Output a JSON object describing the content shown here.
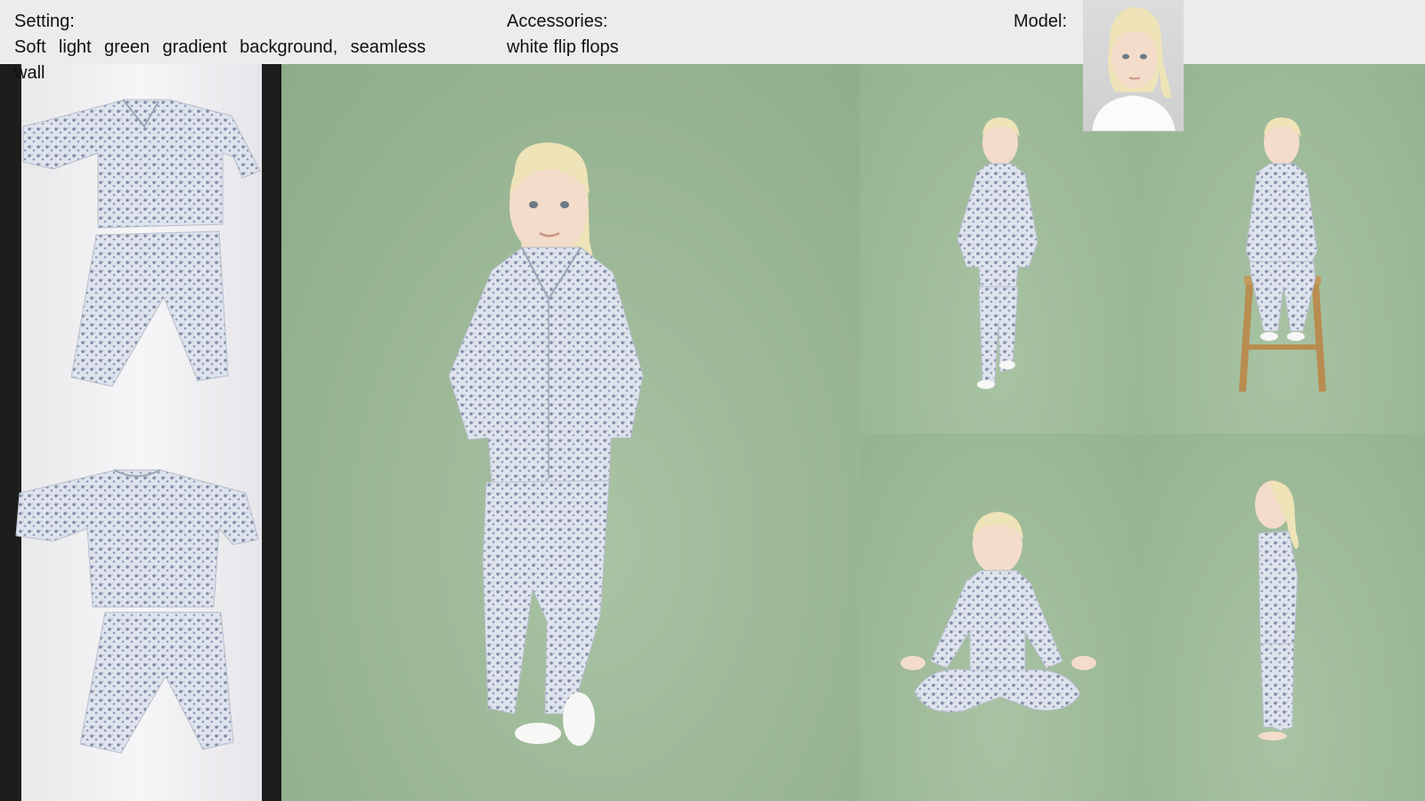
{
  "header": {
    "setting_label": "Setting:",
    "setting_value": "Soft light green gradient background, seamless wall",
    "accessories_label": "Accessories:",
    "accessories_value": "white flip flops",
    "model_label": "Model:"
  },
  "colors": {
    "backdrop_green": "#9cb897",
    "pajama_print": "#c9d0de",
    "hair_blonde": "#efe3b8",
    "header_bg": "#ececec"
  },
  "images": [
    "model-portrait",
    "flat-lay-front",
    "flat-lay-back",
    "main-standing-photo",
    "walking-pose-photo",
    "sitting-stool-photo",
    "meditation-pose-photo",
    "side-profile-photo"
  ]
}
